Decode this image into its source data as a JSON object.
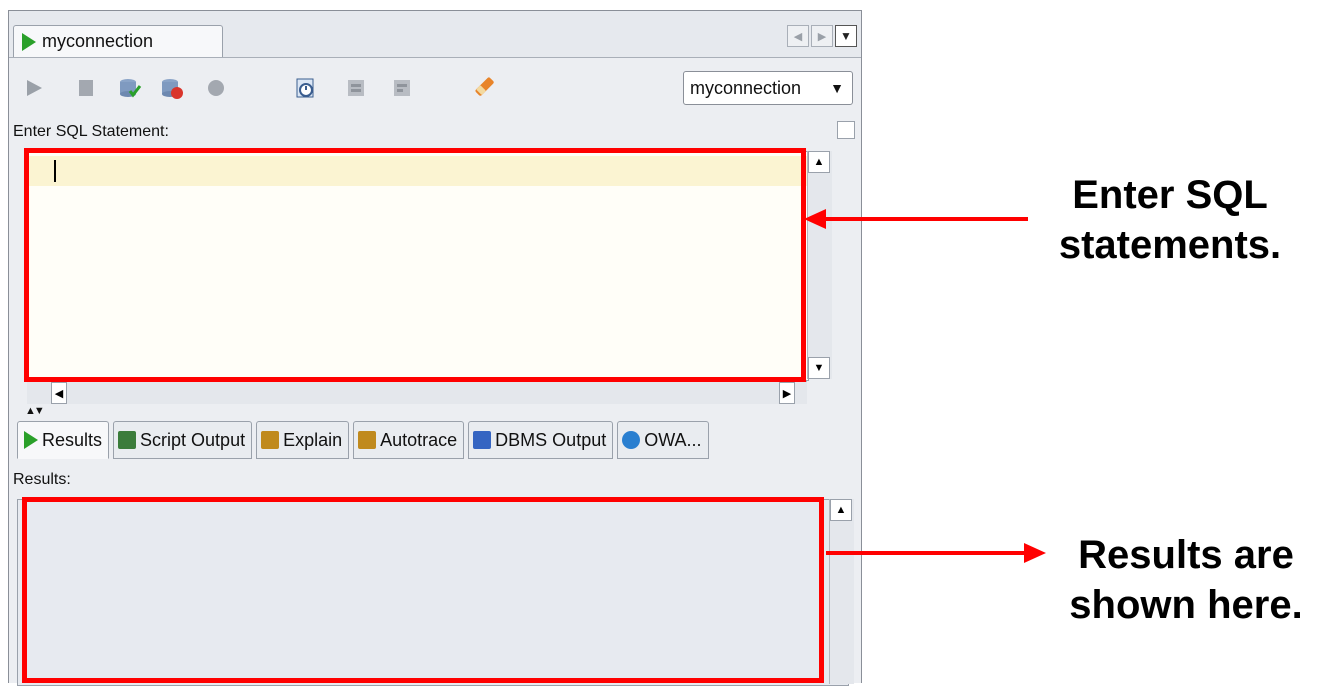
{
  "window": {
    "tab_title": "myconnection",
    "nav_left": "◀",
    "nav_right": "▶",
    "nav_menu": "▼"
  },
  "toolbar": {
    "buttons": [
      "run-statement-icon",
      "stop-icon",
      "commit-icon",
      "rollback-icon",
      "cancel-icon",
      "sql-history-icon",
      "explain-plan-icon",
      "autotrace-icon",
      "clear-icon"
    ],
    "connection_value": "myconnection",
    "connection_arrow": "▼"
  },
  "editor": {
    "label": "Enter SQL Statement:",
    "content": ""
  },
  "results_tabs": [
    {
      "label": "Results",
      "icon": "run-icon",
      "color": "#2aa02a"
    },
    {
      "label": "Script Output",
      "icon": "script-icon",
      "color": "#3b7c3b"
    },
    {
      "label": "Explain",
      "icon": "explain-icon",
      "color": "#c08a1e"
    },
    {
      "label": "Autotrace",
      "icon": "autotrace-icon",
      "color": "#c08a1e"
    },
    {
      "label": "DBMS Output",
      "icon": "dbms-icon",
      "color": "#3565c2"
    },
    {
      "label": "OWA...",
      "icon": "owa-icon",
      "color": "#2a7fd0"
    }
  ],
  "results": {
    "label": "Results:"
  },
  "annotations": {
    "editor_note_line1": "Enter SQL",
    "editor_note_line2": "statements.",
    "results_note_line1": "Results are",
    "results_note_line2": "shown here."
  },
  "colors": {
    "highlight": "#ff0000",
    "accent_green": "#2aa02a"
  }
}
